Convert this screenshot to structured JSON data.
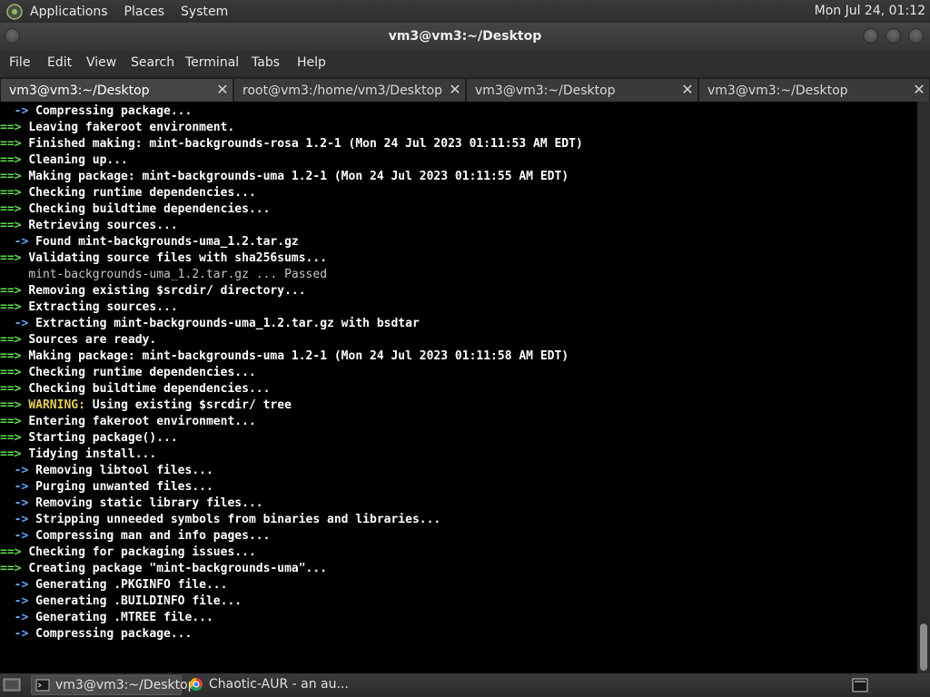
{
  "top_panel": {
    "menus": [
      "Applications",
      "Places",
      "System"
    ],
    "clock": "Mon Jul 24, 01:12"
  },
  "window": {
    "title": "vm3@vm3:~/Desktop"
  },
  "menubar": {
    "items": [
      "File",
      "Edit",
      "View",
      "Search",
      "Terminal",
      "Tabs",
      "Help"
    ]
  },
  "tabs": [
    {
      "label": "vm3@vm3:~/Desktop",
      "active": true
    },
    {
      "label": "root@vm3:/home/vm3/Desktop",
      "active": false
    },
    {
      "label": "vm3@vm3:~/Desktop",
      "active": false
    },
    {
      "label": "vm3@vm3:~/Desktop",
      "active": false
    }
  ],
  "terminal": {
    "colors": {
      "main_prefix": "#5fdf4f",
      "sub_prefix": "#5aa9ff",
      "warning": "#e8d24a",
      "background": "#000000"
    },
    "lines": [
      {
        "p": "  -> ",
        "k": "sub",
        "t": "Compressing package..."
      },
      {
        "p": "==> ",
        "k": "main",
        "t": "Leaving fakeroot environment."
      },
      {
        "p": "==> ",
        "k": "main",
        "t": "Finished making: mint-backgrounds-rosa 1.2-1 (Mon 24 Jul 2023 01:11:53 AM EDT)"
      },
      {
        "p": "==> ",
        "k": "main",
        "t": "Cleaning up..."
      },
      {
        "p": "==> ",
        "k": "main",
        "t": "Making package: mint-backgrounds-uma 1.2-1 (Mon 24 Jul 2023 01:11:55 AM EDT)"
      },
      {
        "p": "==> ",
        "k": "main",
        "t": "Checking runtime dependencies..."
      },
      {
        "p": "==> ",
        "k": "main",
        "t": "Checking buildtime dependencies..."
      },
      {
        "p": "==> ",
        "k": "main",
        "t": "Retrieving sources..."
      },
      {
        "p": "  -> ",
        "k": "sub",
        "t": "Found mint-backgrounds-uma_1.2.tar.gz"
      },
      {
        "p": "==> ",
        "k": "main",
        "t": "Validating source files with sha256sums..."
      },
      {
        "p": "    ",
        "k": "plain",
        "t": "mint-backgrounds-uma_1.2.tar.gz ... Passed"
      },
      {
        "p": "==> ",
        "k": "main",
        "t": "Removing existing $srcdir/ directory..."
      },
      {
        "p": "==> ",
        "k": "main",
        "t": "Extracting sources..."
      },
      {
        "p": "  -> ",
        "k": "sub",
        "t": "Extracting mint-backgrounds-uma_1.2.tar.gz with bsdtar"
      },
      {
        "p": "==> ",
        "k": "main",
        "t": "Sources are ready."
      },
      {
        "p": "==> ",
        "k": "main",
        "t": "Making package: mint-backgrounds-uma 1.2-1 (Mon 24 Jul 2023 01:11:58 AM EDT)"
      },
      {
        "p": "==> ",
        "k": "main",
        "t": "Checking runtime dependencies..."
      },
      {
        "p": "==> ",
        "k": "main",
        "t": "Checking buildtime dependencies..."
      },
      {
        "p": "==> ",
        "k": "main",
        "w": "WARNING:",
        "t": " Using existing $srcdir/ tree"
      },
      {
        "p": "==> ",
        "k": "main",
        "t": "Entering fakeroot environment..."
      },
      {
        "p": "==> ",
        "k": "main",
        "t": "Starting package()..."
      },
      {
        "p": "==> ",
        "k": "main",
        "t": "Tidying install..."
      },
      {
        "p": "  -> ",
        "k": "sub",
        "t": "Removing libtool files..."
      },
      {
        "p": "  -> ",
        "k": "sub",
        "t": "Purging unwanted files..."
      },
      {
        "p": "  -> ",
        "k": "sub",
        "t": "Removing static library files..."
      },
      {
        "p": "  -> ",
        "k": "sub",
        "t": "Stripping unneeded symbols from binaries and libraries..."
      },
      {
        "p": "  -> ",
        "k": "sub",
        "t": "Compressing man and info pages..."
      },
      {
        "p": "==> ",
        "k": "main",
        "t": "Checking for packaging issues..."
      },
      {
        "p": "==> ",
        "k": "main",
        "t": "Creating package \"mint-backgrounds-uma\"..."
      },
      {
        "p": "  -> ",
        "k": "sub",
        "t": "Generating .PKGINFO file..."
      },
      {
        "p": "  -> ",
        "k": "sub",
        "t": "Generating .BUILDINFO file..."
      },
      {
        "p": "  -> ",
        "k": "sub",
        "t": "Generating .MTREE file..."
      },
      {
        "p": "  -> ",
        "k": "sub",
        "t": "Compressing package..."
      }
    ]
  },
  "taskbar": {
    "items": [
      {
        "label": "vm3@vm3:~/Desktop",
        "icon": "terminal-icon",
        "active": true
      },
      {
        "label": "Chaotic-AUR - an au...",
        "icon": "chrome-icon",
        "active": false
      }
    ]
  }
}
